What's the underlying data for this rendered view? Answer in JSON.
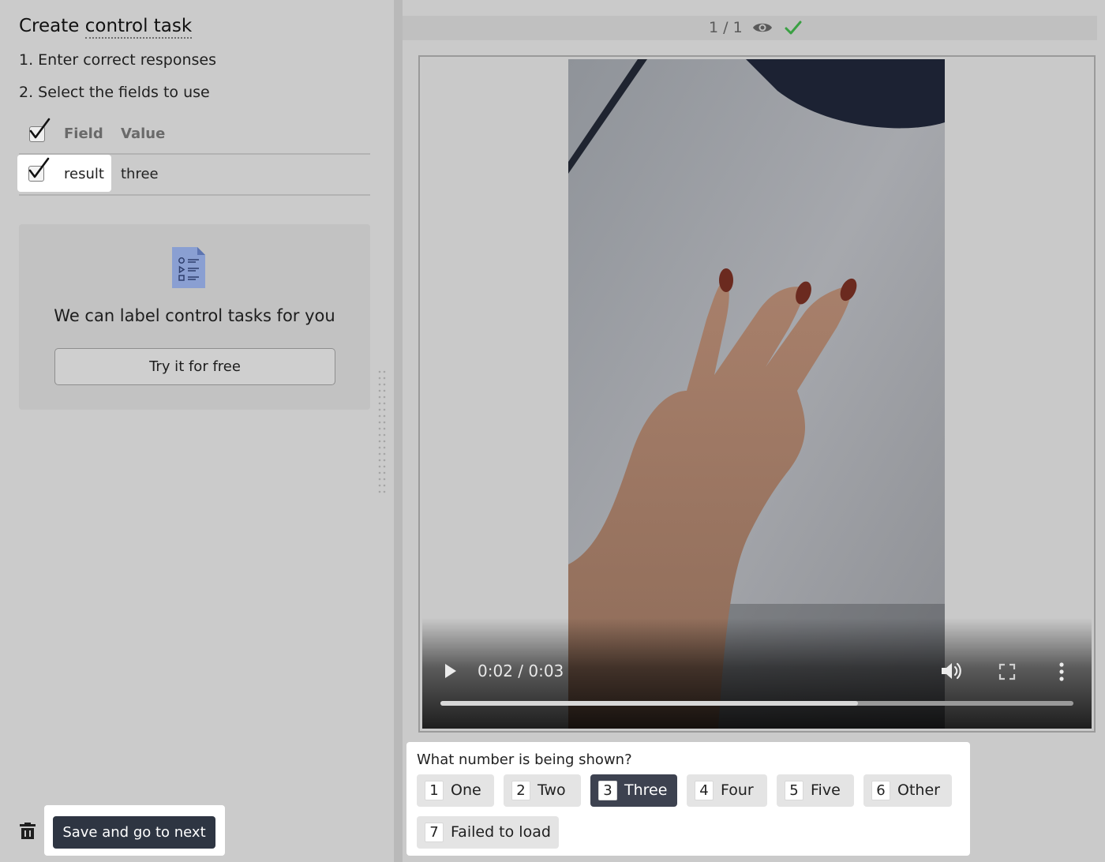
{
  "left": {
    "title_prefix": "Create ",
    "title_link": "control task",
    "step1": "1. Enter correct responses",
    "step2": "2. Select the fields to use",
    "table": {
      "headers": {
        "field": "Field",
        "value": "Value"
      },
      "rows": [
        {
          "field": "result",
          "value": "three",
          "checked": true
        }
      ]
    },
    "promo": {
      "text": "We can label control tasks for you",
      "button": "Try it for free"
    },
    "save_button": "Save and go to next"
  },
  "right": {
    "counter": "1 / 1",
    "video": {
      "time": "0:02 / 0:03",
      "progress": 0.66
    },
    "question": "What number is being shown?",
    "options": [
      {
        "key": "1",
        "label": "One"
      },
      {
        "key": "2",
        "label": "Two"
      },
      {
        "key": "3",
        "label": "Three",
        "selected": true
      },
      {
        "key": "4",
        "label": "Four"
      },
      {
        "key": "5",
        "label": "Five"
      },
      {
        "key": "6",
        "label": "Other"
      },
      {
        "key": "7",
        "label": "Failed to load"
      }
    ]
  },
  "colors": {
    "selected_option": "#3d4250",
    "check_green": "#3aa043",
    "save_button": "#2e3542"
  }
}
